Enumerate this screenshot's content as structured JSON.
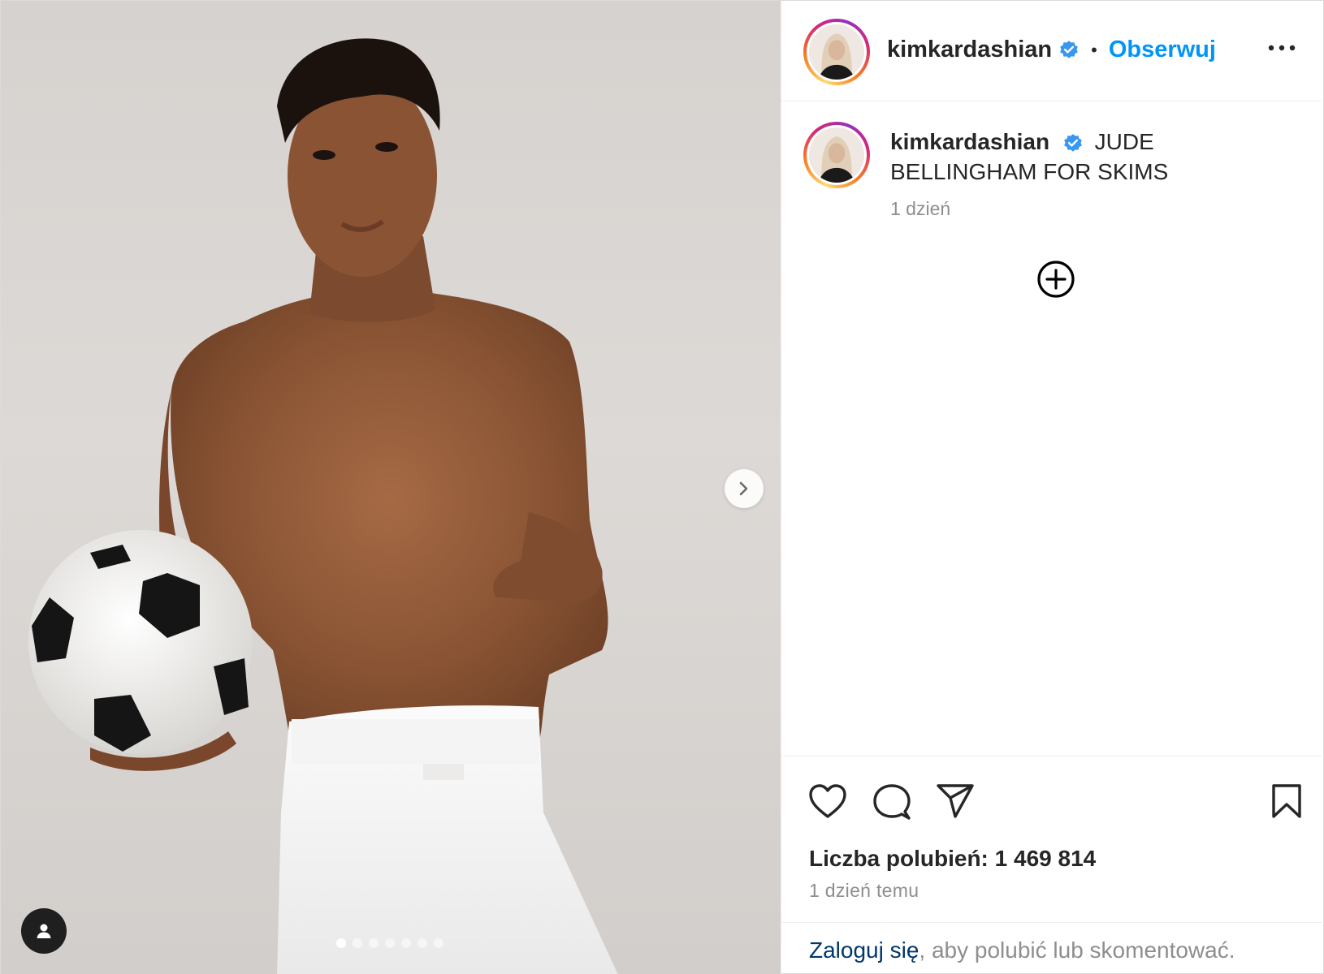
{
  "post": {
    "username": "kimkardashian",
    "verified": true,
    "follow_label": "Obserwuj",
    "separator": "•",
    "caption_text": "JUDE BELLINGHAM FOR SKIMS",
    "caption_time": "1 dzień",
    "likes_text": "Liczba polubień: 1 469 814",
    "post_time": "1 dzień temu",
    "login_link": "Zaloguj się",
    "login_rest": ", aby polubić lub skomentować.",
    "carousel": {
      "total_slides": 7,
      "current_slide": 1
    }
  },
  "icons": {
    "more": "more-options-icon",
    "verified": "verified-badge-icon",
    "load_more": "plus-circle-icon",
    "like": "heart-icon",
    "comment": "comment-icon",
    "share": "send-icon",
    "save": "bookmark-icon",
    "next": "chevron-right-icon",
    "tags": "user-tag-icon"
  },
  "colors": {
    "accent": "#0095f6",
    "text": "#262626",
    "muted": "#8e8e8e",
    "link_dark": "#00376b"
  }
}
